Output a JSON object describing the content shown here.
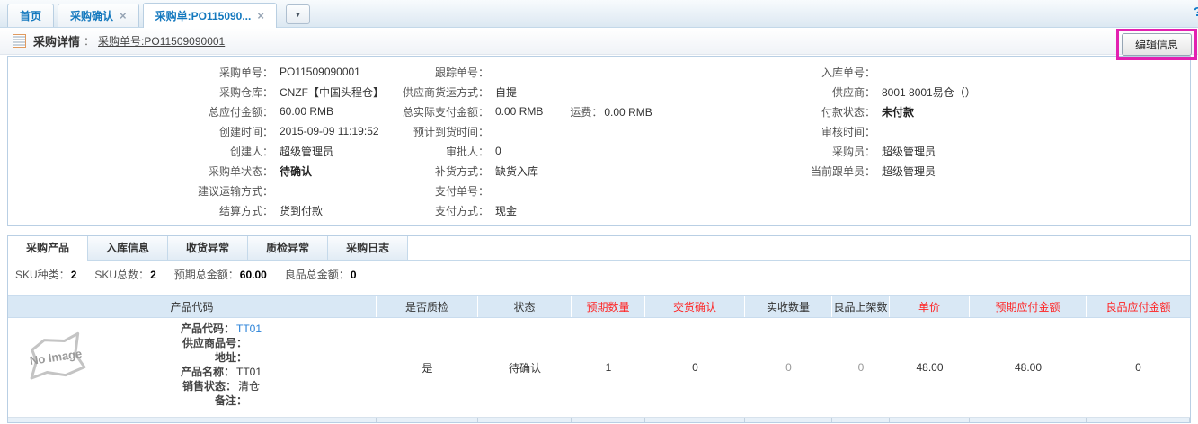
{
  "colors": {
    "accent_blue": "#1378be",
    "header_red": "#ff2222",
    "highlight_magenta": "#e321b0",
    "link_blue": "#2a82d8"
  },
  "tab_bar": {
    "help_icon": "?",
    "close_icon": "×",
    "dropdown_icon": "▼",
    "tabs": [
      {
        "label": "首页"
      },
      {
        "label": "采购确认"
      },
      {
        "label": "采购单:PO115090..."
      }
    ]
  },
  "header": {
    "title": "采购详情",
    "separator": "：",
    "order_link": "采购单号:PO11509090001",
    "edit_button": "编辑信息"
  },
  "details": {
    "rows": [
      {
        "c1l": "采购单号：",
        "c1v": "PO11509090001",
        "c2l": "跟踪单号：",
        "c2v": "",
        "c3l": "入库单号：",
        "c3v": ""
      },
      {
        "c1l": "采购仓库：",
        "c1v": "CNZF【中国头程仓】",
        "c2l": "供应商货运方式：",
        "c2v": "自提",
        "c3l": "供应商：",
        "c3v": "8001 8001易仓（）"
      },
      {
        "c1l": "总应付金额：",
        "c1v": "60.00 RMB",
        "c2l": "总实际支付金额：",
        "c2v": "0.00 RMB",
        "c2xl": "运费：",
        "c2xv": "0.00 RMB",
        "c3l": "付款状态：",
        "c3v": "未付款"
      },
      {
        "c1l": "创建时间：",
        "c1v": "2015-09-09 11:19:52",
        "c2l": "预计到货时间：",
        "c2v": "",
        "c3l": "审核时间：",
        "c3v": ""
      },
      {
        "c1l": "创建人：",
        "c1v": "超级管理员",
        "c2l": "审批人：",
        "c2v": "0",
        "c3l": "采购员：",
        "c3v": "超级管理员"
      },
      {
        "c1l": "采购单状态：",
        "c1v": "待确认",
        "c2l": "补货方式：",
        "c2v": "缺货入库",
        "c3l": "当前跟单员：",
        "c3v": "超级管理员"
      },
      {
        "c1l": "建议运输方式：",
        "c1v": "",
        "c2l": "支付单号：",
        "c2v": "",
        "c3l": "",
        "c3v": ""
      },
      {
        "c1l": "结算方式：",
        "c1v": "货到付款",
        "c2l": "支付方式：",
        "c2v": "现金",
        "c3l": "",
        "c3v": ""
      }
    ]
  },
  "sub_tabs": {
    "items": [
      {
        "label": "采购产品"
      },
      {
        "label": "入库信息"
      },
      {
        "label": "收货异常"
      },
      {
        "label": "质检异常"
      },
      {
        "label": "采购日志"
      }
    ]
  },
  "summary": {
    "items": [
      {
        "label": "SKU种类：",
        "value": "2"
      },
      {
        "label": "SKU总数：",
        "value": "2"
      },
      {
        "label": "预期总金额：",
        "value": "60.00"
      },
      {
        "label": "良品总金额：",
        "value": "0"
      }
    ]
  },
  "table": {
    "headers": [
      {
        "label": "产品代码"
      },
      {
        "label": "是否质检"
      },
      {
        "label": "状态"
      },
      {
        "label": "预期数量"
      },
      {
        "label": "交货确认"
      },
      {
        "label": "实收数量"
      },
      {
        "label": "良品上架数"
      },
      {
        "label": "单价"
      },
      {
        "label": "预期应付金额"
      },
      {
        "label": "良品应付金额"
      }
    ],
    "row": {
      "no_image_text": "No Image",
      "info": [
        {
          "label": "产品代码：",
          "value": "TT01"
        },
        {
          "label": "供应商品号：",
          "value": ""
        },
        {
          "label": "地址：",
          "value": ""
        },
        {
          "label": "产品名称：",
          "value": "TT01"
        },
        {
          "label": "销售状态：",
          "value": "清仓"
        },
        {
          "label": "备注：",
          "value": ""
        }
      ],
      "cells": {
        "qc": "是",
        "status": "待确认",
        "expected_qty": "1",
        "delivery_confirm": "0",
        "received_qty": "0",
        "good_shelved": "0",
        "unit_price": "48.00",
        "expected_payable": "48.00",
        "good_payable": "0"
      }
    }
  }
}
